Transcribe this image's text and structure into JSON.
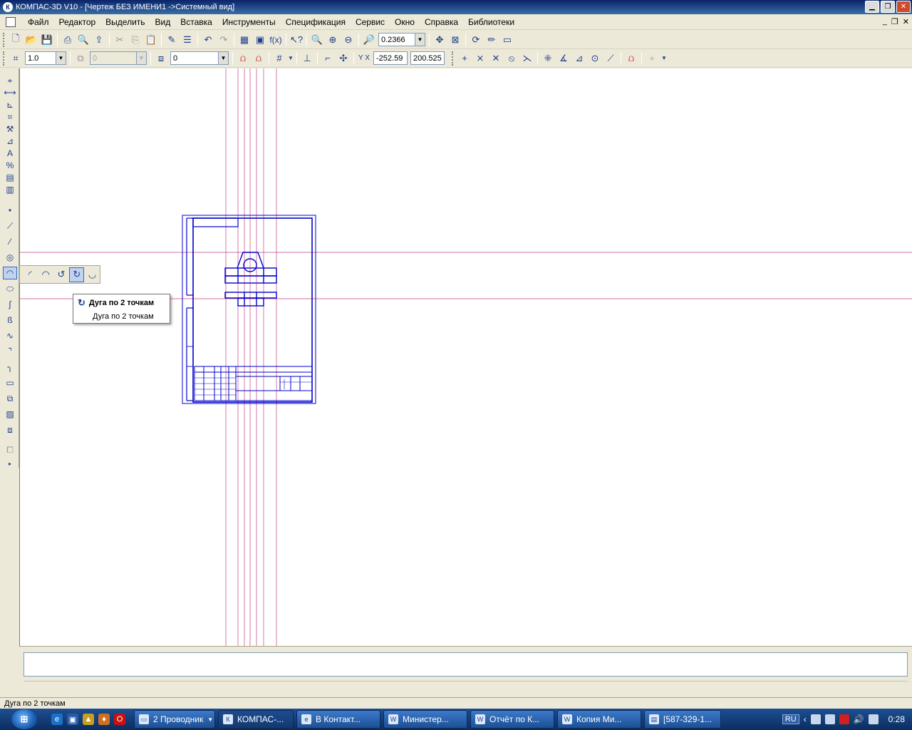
{
  "window": {
    "title": "КОМПАС-3D V10 - [Чертеж БЕЗ ИМЕНИ1 ->Системный вид]",
    "app_icon_letter": "К"
  },
  "menu": {
    "items": [
      "Файл",
      "Редактор",
      "Выделить",
      "Вид",
      "Вставка",
      "Инструменты",
      "Спецификация",
      "Сервис",
      "Окно",
      "Справка",
      "Библиотеки"
    ]
  },
  "toolbar": {
    "zoom_value": "0.2366",
    "line_scale": "1.0",
    "layer_value": "0",
    "style_value": "0",
    "coord_x": "-252.59",
    "coord_y": "200.525",
    "formula_label": "f(x)"
  },
  "flyout": {
    "tooltip_title": "Дуга по 2 точкам",
    "tooltip_desc": "Дуга по 2 точкам"
  },
  "status": {
    "text": "Дуга по 2 точкам"
  },
  "taskbar": {
    "start_label": "⊞",
    "tasks": [
      {
        "label": "2 Проводник",
        "active": false
      },
      {
        "label": "КОМПАС-...",
        "active": true
      },
      {
        "label": "В Контакт...",
        "active": false
      },
      {
        "label": "Министер...",
        "active": false
      },
      {
        "label": "Отчёт по К...",
        "active": false
      },
      {
        "label": "Копия Ми...",
        "active": false
      },
      {
        "label": "[587-329-1...",
        "active": false
      }
    ],
    "lang": "RU",
    "clock": "0:28"
  },
  "colors": {
    "drawing_line": "#0000cc",
    "guide_line": "#c0408a",
    "title_gradient_start": "#0a246a"
  }
}
